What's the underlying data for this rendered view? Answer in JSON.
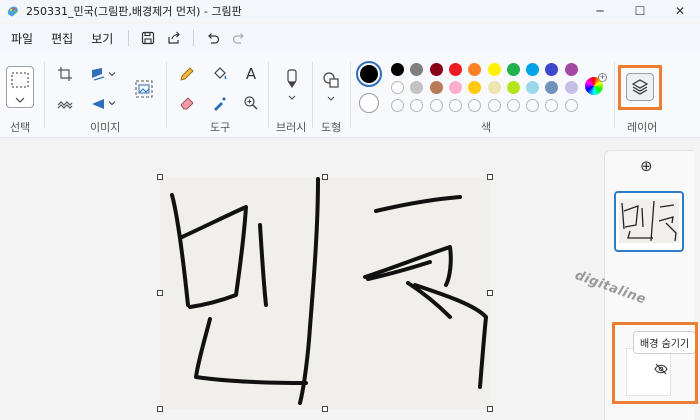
{
  "window": {
    "title": "250331_민국(그림판,배경제거 먼저) - 그림판",
    "controls": [
      "─",
      "☐",
      "✕"
    ]
  },
  "menu": {
    "items": [
      "파일",
      "편집",
      "보기"
    ]
  },
  "ribbon": {
    "groups": {
      "selection": "선택",
      "image": "이미지",
      "tools": "도구",
      "brushes": "브러시",
      "shapes": "도형",
      "colors": "색",
      "layers": "레이어"
    },
    "tools_text_glyph": "A",
    "palette": {
      "row1": [
        "#000000",
        "#7f7f7f",
        "#880015",
        "#ed1c24",
        "#ff7f27",
        "#fff200",
        "#22b14c",
        "#00a2e8",
        "#3f48cc",
        "#a349a4"
      ],
      "row2": [
        "#ffffff",
        "#c3c3c3",
        "#b97a57",
        "#ffaec9",
        "#ffc90e",
        "#efe4b0",
        "#b5e61d",
        "#99d9ea",
        "#7092be",
        "#c8bfe7"
      ],
      "row3_empty_count": 10,
      "primary": "#000000",
      "secondary": "#ffffff"
    },
    "highlight_color": "#ed7d31"
  },
  "layers_panel": {
    "add_glyph": "⊕",
    "tooltip": "배경 숨기기"
  },
  "watermark": "digitaline"
}
